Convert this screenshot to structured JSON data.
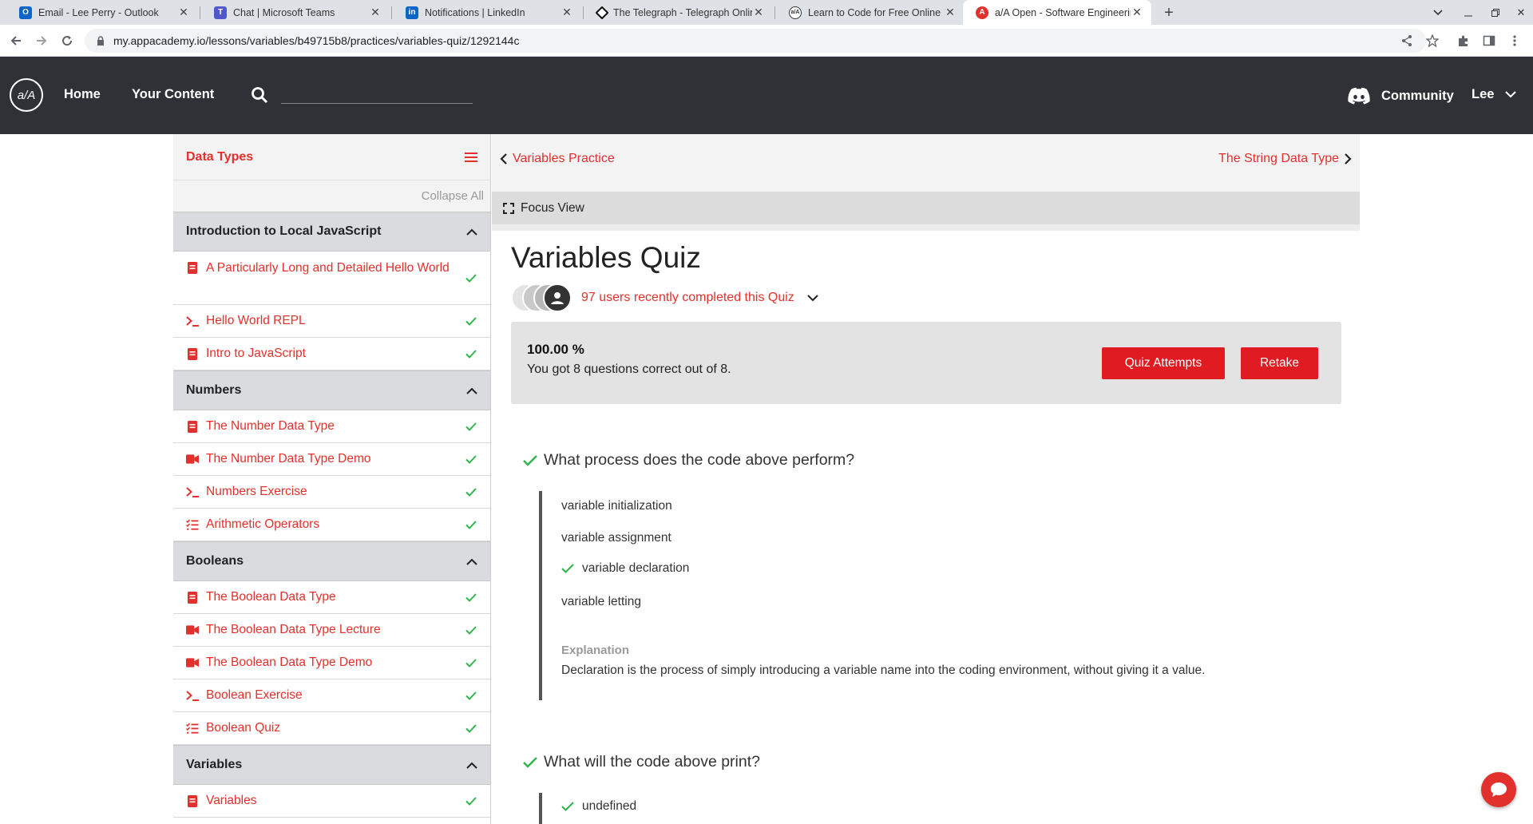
{
  "browser": {
    "tabs": [
      {
        "title": "Email - Lee Perry - Outlook",
        "icon": "outlook-icon",
        "color": "#0a64c9"
      },
      {
        "title": "Chat | Microsoft Teams",
        "icon": "teams-icon",
        "color": "#5059c9"
      },
      {
        "title": "Notifications | LinkedIn",
        "icon": "linkedin-icon",
        "color": "#0a66c2"
      },
      {
        "title": "The Telegraph - Telegraph Online",
        "icon": "telegraph-icon",
        "color": "#111111"
      },
      {
        "title": "Learn to Code for Free Online - A",
        "icon": "appacademy-icon",
        "color": "#333333"
      },
      {
        "title": "a/A Open - Software Engineering",
        "icon": "aa-open-icon",
        "color": "#e2312d"
      }
    ],
    "url": "my.appacademy.io/lessons/variables/b49715b8/practices/variables-quiz/1292144c"
  },
  "header": {
    "logo_text": "a/A",
    "nav": {
      "home": "Home",
      "content": "Your Content"
    },
    "search_placeholder": "",
    "community": "Community",
    "user": "Lee"
  },
  "sidebar": {
    "title": "Data Types",
    "collapse_all": "Collapse All",
    "sections": [
      {
        "title": "Introduction to Local JavaScript",
        "items": [
          {
            "label": "A Particularly Long and Detailed Hello World",
            "type": "reading",
            "done": true
          },
          {
            "label": "Hello World REPL",
            "type": "exercise",
            "done": true
          },
          {
            "label": "Intro to JavaScript",
            "type": "reading",
            "done": true
          }
        ]
      },
      {
        "title": "Numbers",
        "items": [
          {
            "label": "The Number Data Type",
            "type": "reading",
            "done": true
          },
          {
            "label": "The Number Data Type Demo",
            "type": "video",
            "done": true
          },
          {
            "label": "Numbers Exercise",
            "type": "exercise",
            "done": true
          },
          {
            "label": "Arithmetic Operators",
            "type": "quiz",
            "done": true
          }
        ]
      },
      {
        "title": "Booleans",
        "items": [
          {
            "label": "The Boolean Data Type",
            "type": "reading",
            "done": true
          },
          {
            "label": "The Boolean Data Type Lecture",
            "type": "video",
            "done": true
          },
          {
            "label": "The Boolean Data Type Demo",
            "type": "video",
            "done": true
          },
          {
            "label": "Boolean Exercise",
            "type": "exercise",
            "done": true
          },
          {
            "label": "Boolean Quiz",
            "type": "quiz",
            "done": true
          }
        ]
      },
      {
        "title": "Variables",
        "items": [
          {
            "label": "Variables",
            "type": "reading",
            "done": true
          }
        ]
      }
    ]
  },
  "content": {
    "prev": "Variables Practice",
    "next": "The String Data Type",
    "focus_view": "Focus View",
    "title": "Variables Quiz",
    "completed_text": "97 users recently completed this Quiz",
    "score": {
      "percent": "100.00 %",
      "summary": "You got 8 questions correct out of 8.",
      "attempts_button": "Quiz Attempts",
      "retake_button": "Retake"
    },
    "questions": [
      {
        "question": "What process does the code above perform?",
        "options": [
          {
            "text": "variable initialization",
            "correct": false
          },
          {
            "text": "variable assignment",
            "correct": false
          },
          {
            "text": "variable declaration",
            "correct": true
          },
          {
            "text": "variable letting",
            "correct": false
          }
        ],
        "explanation_label": "Explanation",
        "explanation": "Declaration is the process of simply introducing a variable name into the coding environment, without giving it a value."
      },
      {
        "question": "What will the code above print?",
        "options": [
          {
            "text": "undefined",
            "correct": true
          }
        ]
      }
    ]
  },
  "colors": {
    "accent": "#e2312d",
    "check": "#2fb34a",
    "header_bg": "#2f3136"
  }
}
